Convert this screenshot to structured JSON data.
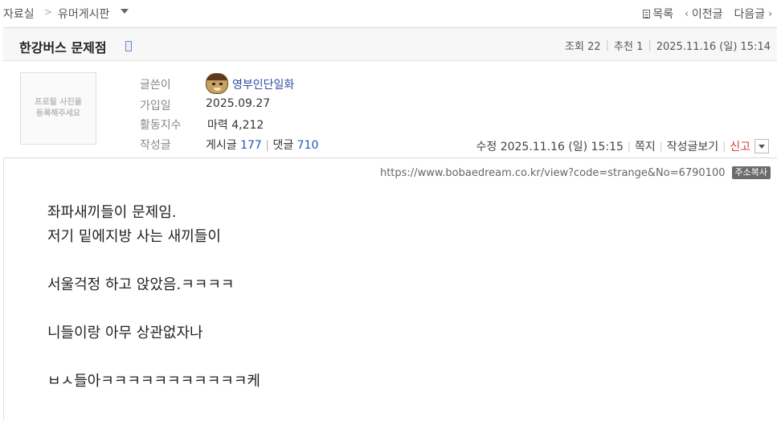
{
  "nav": {
    "breadcrumb_home": "자료실",
    "breadcrumb_sep": ">",
    "breadcrumb_board": "유머게시판",
    "list_label": "목록",
    "prev_label": "이전글",
    "next_label": "다음글"
  },
  "post": {
    "title": "한강버스 문제점",
    "views_label": "조회 22",
    "recommend_label": "추천 1",
    "datetime": "2025.11.16 (일) 15:14"
  },
  "author": {
    "profile_placeholder_line1": "프로필 사진을",
    "profile_placeholder_line2": "등록해주세요",
    "writer_label": "글쓴이",
    "writer_name": "영부인단일화",
    "joined_label": "가입일",
    "joined_value": "2025.09.27",
    "activity_label": "활동지수",
    "activity_value": "마력 4,212",
    "posts_label": "작성글",
    "posts_prefix": "게시글",
    "posts_count": "177",
    "posts_sep": "|",
    "comments_prefix": "댓글",
    "comments_count": "710"
  },
  "actions": {
    "edited": "수정 2025.11.16 (일) 15:15",
    "message": "쪽지",
    "view_posts": "작성글보기",
    "report": "신고"
  },
  "url": {
    "text": "https://www.bobaedream.co.kr/view?code=strange&No=6790100",
    "copy_label": "주소복사"
  },
  "content": {
    "lines": [
      "좌파새끼들이 문제임.",
      "저기 밑에지방 사는 새끼들이",
      "",
      "서울걱정 하고 앉았음.ㅋㅋㅋㅋ",
      "",
      "니들이랑 아무 상관없자나",
      "",
      "ㅂㅅ들아ㅋㅋㅋㅋㅋㅋㅋㅋㅋㅋㅋ케"
    ]
  }
}
